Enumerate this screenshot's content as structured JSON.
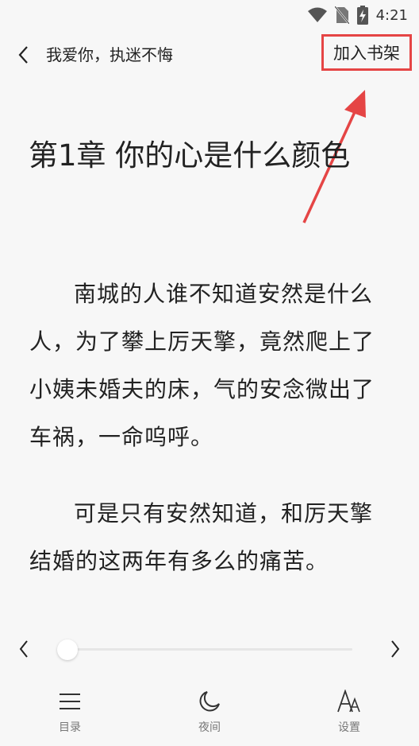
{
  "status_bar": {
    "time": "4:21"
  },
  "header": {
    "book_title": "我爱你，执迷不悔",
    "add_to_shelf_label": "加入书架"
  },
  "chapter": {
    "title": "第1章 你的心是什么颜色",
    "paragraphs": [
      "南城的人谁不知道安然是什么人，为了攀上厉天擎，竟然爬上了小姨未婚夫的床，气的安念微出了车祸，一命呜呼。",
      "可是只有安然知道，和厉天擎结婚的这两年有多么的痛苦。"
    ]
  },
  "progress": {
    "value_fraction": 0.0
  },
  "bottom_nav": {
    "items": [
      {
        "label": "目录",
        "icon": "menu-icon"
      },
      {
        "label": "夜间",
        "icon": "moon-icon"
      },
      {
        "label": "设置",
        "icon": "font-settings-icon"
      }
    ]
  },
  "colors": {
    "background": "#f7f7f7",
    "annotation_red": "#e54545",
    "text": "#222222"
  }
}
